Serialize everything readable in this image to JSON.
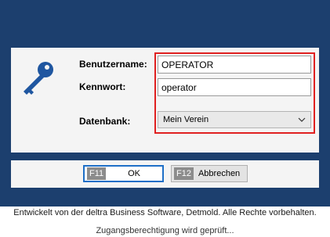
{
  "colors": {
    "background": "#1c3f6e",
    "panel": "#f4f4f4",
    "highlight_border": "#e02020",
    "key_icon": "#1f56a0",
    "focus_border": "#1e6fc7"
  },
  "login": {
    "key_icon": "key-icon",
    "username_label": "Benutzername:",
    "username_value": "OPERATOR",
    "password_label": "Kennwort:",
    "password_value": "operator",
    "database_label": "Datenbank:",
    "database_selected": "Mein Verein",
    "database_dropdown_icon": "chevron-down-icon"
  },
  "buttons": {
    "ok": {
      "key": "F11",
      "label": "OK"
    },
    "cancel": {
      "key": "F12",
      "label": "Abbrechen"
    }
  },
  "footer": {
    "copyright": "Entwickelt von der deltra Business Software, Detmold. Alle Rechte vorbehalten.",
    "status": "Zugangsberechtigung wird geprüft..."
  }
}
